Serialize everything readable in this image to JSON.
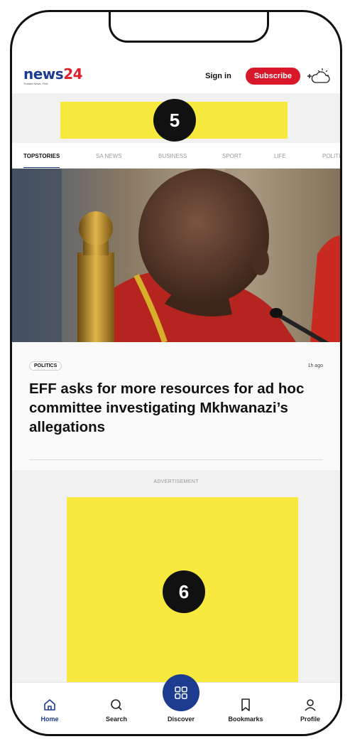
{
  "header": {
    "logo_text": "news",
    "logo_number": "24",
    "logo_tagline": "Trusted News. First",
    "sign_in": "Sign in",
    "subscribe": "Subscribe"
  },
  "badges": {
    "top_ad": "5",
    "bottom_ad": "6"
  },
  "tabs": [
    {
      "label": "TOPSTORIES",
      "active": true
    },
    {
      "label": "SA NEWS",
      "active": false
    },
    {
      "label": "BUSINESS",
      "active": false
    },
    {
      "label": "SPORT",
      "active": false
    },
    {
      "label": "LIFE",
      "active": false
    },
    {
      "label": "POLITICS",
      "active": false
    }
  ],
  "article": {
    "category": "POLITICS",
    "time_ago": "1h ago",
    "headline": "EFF asks for more resources for ad hoc committee investigating Mkhwanazi’s allegations"
  },
  "advert": {
    "label": "ADVERTISEMENT"
  },
  "bottom_nav": [
    {
      "label": "Home",
      "icon": "home-icon",
      "active": true
    },
    {
      "label": "Search",
      "icon": "search-icon",
      "active": false
    },
    {
      "label": "Discover",
      "icon": "grid-icon",
      "active": false
    },
    {
      "label": "Bookmarks",
      "icon": "bookmark-icon",
      "active": false
    },
    {
      "label": "Profile",
      "icon": "profile-icon",
      "active": false
    }
  ],
  "colors": {
    "brand_blue": "#1d3c8f",
    "brand_red": "#d9172a",
    "ad_yellow": "#f7e93d"
  }
}
